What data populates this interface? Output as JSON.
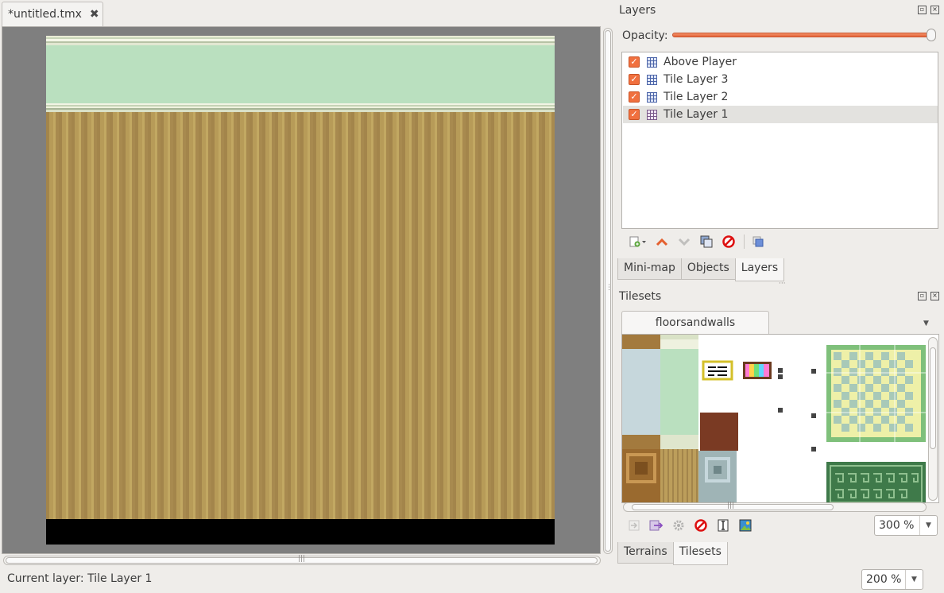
{
  "document": {
    "tab_title": "*untitled.tmx",
    "close_glyph": "✖"
  },
  "status": {
    "current_layer": "Current layer: Tile Layer 1",
    "zoom": "200 %"
  },
  "layers_panel": {
    "title": "Layers",
    "opacity_label": "Opacity:",
    "opacity_value": 1.0,
    "layers": [
      {
        "name": "Above Player",
        "visible": true,
        "selected": false
      },
      {
        "name": "Tile Layer 3",
        "visible": true,
        "selected": false
      },
      {
        "name": "Tile Layer 2",
        "visible": true,
        "selected": false
      },
      {
        "name": "Tile Layer 1",
        "visible": true,
        "selected": true
      }
    ],
    "toolbar": [
      "add-layer-icon",
      "raise-layer-icon",
      "lower-layer-icon",
      "duplicate-layer-icon",
      "remove-layer-icon",
      "show-hide-others-icon"
    ],
    "tabs": [
      "Mini-map",
      "Objects",
      "Layers"
    ],
    "active_tab": "Layers"
  },
  "tilesets_panel": {
    "title": "Tilesets",
    "tileset_tab": "floorsandwalls",
    "toolbar": [
      "import-tileset-icon",
      "export-tileset-icon",
      "tileset-properties-icon",
      "remove-tileset-icon",
      "edit-terrain-icon",
      "image-icon"
    ],
    "zoom": "300 %",
    "tabs": [
      "Terrains",
      "Tilesets"
    ],
    "active_tab": "Tilesets"
  },
  "colors": {
    "accent": "#f0703f",
    "wall": "#bae0bf",
    "floor": "#b79b58",
    "canvas_bg": "#7f7f7f"
  }
}
